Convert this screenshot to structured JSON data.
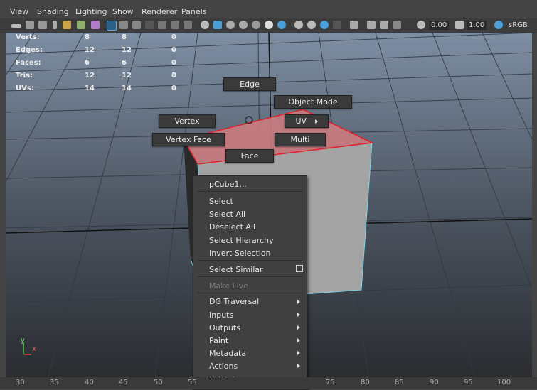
{
  "menubar": [
    "View",
    "Shading",
    "Lighting",
    "Show",
    "Renderer",
    "Panels"
  ],
  "toolbar": {
    "value1": "0.00",
    "value2": "1.00",
    "colorspace": "sRGB"
  },
  "hud": {
    "rows": [
      {
        "label": "Verts:",
        "v1": "8",
        "v2": "8",
        "v3": "0"
      },
      {
        "label": "Edges:",
        "v1": "12",
        "v2": "12",
        "v3": "0"
      },
      {
        "label": "Faces:",
        "v1": "6",
        "v2": "6",
        "v3": "0"
      },
      {
        "label": "Tris:",
        "v1": "12",
        "v2": "12",
        "v3": "0"
      },
      {
        "label": "UVs:",
        "v1": "14",
        "v2": "14",
        "v3": "0"
      }
    ]
  },
  "marking_menu": {
    "edge": "Edge",
    "object_mode": "Object Mode",
    "vertex": "Vertex",
    "uv": "UV",
    "vertex_face": "Vertex Face",
    "multi": "Multi",
    "face": "Face"
  },
  "context_menu": {
    "title": "pCube1...",
    "select": "Select",
    "select_all": "Select All",
    "deselect_all": "Deselect All",
    "select_hierarchy": "Select Hierarchy",
    "invert_selection": "Invert Selection",
    "select_similar": "Select Similar",
    "make_live": "Make Live",
    "dg_traversal": "DG Traversal",
    "inputs": "Inputs",
    "outputs": "Outputs",
    "paint": "Paint",
    "metadata": "Metadata",
    "actions": "Actions",
    "uv_sets": "UV Sets"
  },
  "axis": {
    "y": "y",
    "x": "x"
  },
  "timeline": [
    "30",
    "35",
    "40",
    "45",
    "50",
    "55",
    "75",
    "80",
    "85",
    "90",
    "95",
    "100"
  ],
  "colors": {
    "selection_edge": "#e0202a",
    "cube_face": "#9a9a9a",
    "cube_edge": "#7fd3e8",
    "accent": "#4a9fd8"
  }
}
